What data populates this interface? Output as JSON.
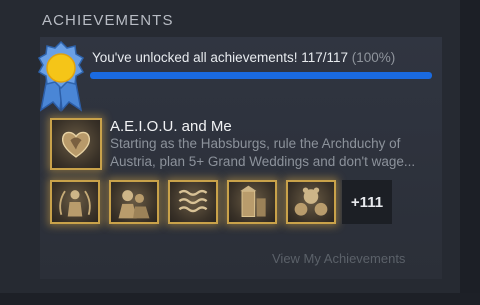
{
  "section": {
    "title": "ACHIEVEMENTS"
  },
  "summary": {
    "text": "You've unlocked all achievements! 117/117",
    "percent_text": "(100%)",
    "progress": 1.0,
    "icon": "achievement-ribbon-badge-icon"
  },
  "featured": {
    "title": "A.E.I.O.U. and Me",
    "description": "Starting as the Habsburgs, rule the Archduchy of Austria, plan 5+ Grand Weddings and don't wage...",
    "icon": "lion-heart-shield-icon"
  },
  "recent": [
    {
      "icon": "knight-wreath-icon"
    },
    {
      "icon": "soldiers-icon"
    },
    {
      "icon": "waves-icon"
    },
    {
      "icon": "tower-map-icon"
    },
    {
      "icon": "bear-cubs-icon"
    }
  ],
  "more": {
    "label": "+111"
  },
  "footer": {
    "link": "View My Achievements"
  },
  "colors": {
    "background": "#262a32",
    "panel": "#2e323c",
    "progress": "#1a6ae0",
    "gold_border": "#c9a24a"
  }
}
